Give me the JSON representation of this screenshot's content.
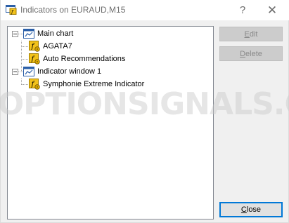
{
  "window": {
    "title": "Indicators on EURAUD,M15",
    "help_glyph": "?",
    "close_glyph": "✕"
  },
  "tree": {
    "groups": [
      {
        "label": "Main chart",
        "icon": "chart-window-icon",
        "items": [
          {
            "label": "AGATA7",
            "icon": "custom-indicator-icon"
          },
          {
            "label": "Auto Recommendations",
            "icon": "custom-indicator-icon"
          }
        ]
      },
      {
        "label": "Indicator window 1",
        "icon": "chart-window-icon",
        "items": [
          {
            "label": "Symphonie Extreme Indicator",
            "icon": "custom-indicator-icon"
          }
        ]
      }
    ]
  },
  "buttons": {
    "edit": {
      "first": "E",
      "rest": "dit"
    },
    "delete": {
      "first": "D",
      "rest": "elete"
    },
    "close": {
      "first": "C",
      "rest": "lose"
    }
  },
  "watermark": "WINOPTIONSIGNALS.COM",
  "colors": {
    "accent": "#0078d7",
    "indicator_icon": "#f2c21b",
    "chart_icon": "#2b5fa8"
  }
}
